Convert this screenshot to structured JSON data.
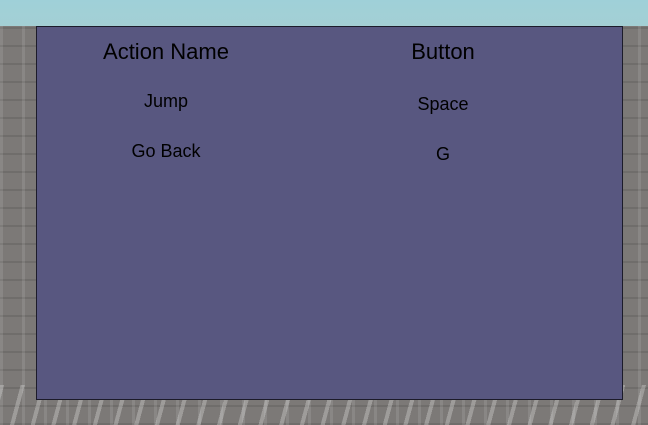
{
  "table": {
    "headers": {
      "action": "Action Name",
      "button": "Button"
    },
    "rows": [
      {
        "action": "Jump",
        "button": "Space"
      },
      {
        "action": "Go Back",
        "button": "G"
      }
    ]
  },
  "colors": {
    "panel_background": "#585780",
    "sky": "#9fd0d8",
    "ground": "#7c7977",
    "text": "#000000"
  }
}
